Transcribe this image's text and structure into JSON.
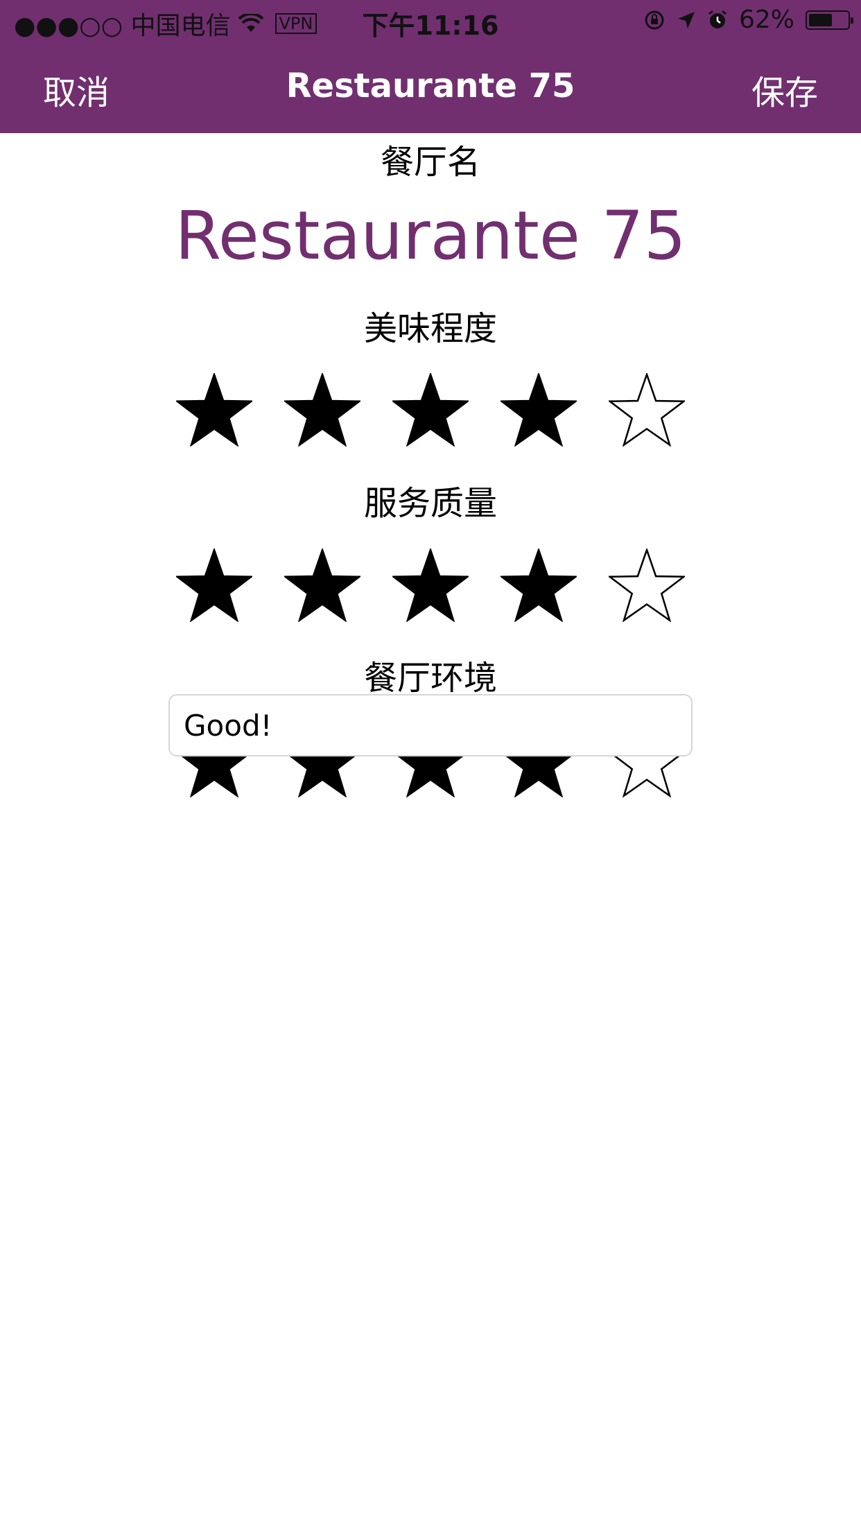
{
  "status_bar": {
    "carrier": "●●●○○ 中国电信",
    "vpn": "VPN",
    "time": "下午11:16",
    "battery_text": "62%",
    "battery_level": 0.62,
    "signal_strength": 3,
    "signal_max": 5
  },
  "nav": {
    "cancel_label": "取消",
    "title": "Restaurante 75",
    "save_label": "保存"
  },
  "form": {
    "name_label": "餐厅名",
    "name_value": "Restaurante 75",
    "ratings": [
      {
        "label": "美味程度",
        "value": 4,
        "max": 5
      },
      {
        "label": "服务质量",
        "value": 4,
        "max": 5
      },
      {
        "label": "餐厅环境",
        "value": 4,
        "max": 5
      }
    ],
    "comment_value": "Good!"
  },
  "colors": {
    "brand": "#712f70",
    "star": "#000000",
    "field_border": "#d6d6d6"
  },
  "icons": [
    "wifi-icon",
    "rotation-lock-icon",
    "location-arrow-icon",
    "alarm-icon",
    "battery-icon",
    "star-icon"
  ]
}
